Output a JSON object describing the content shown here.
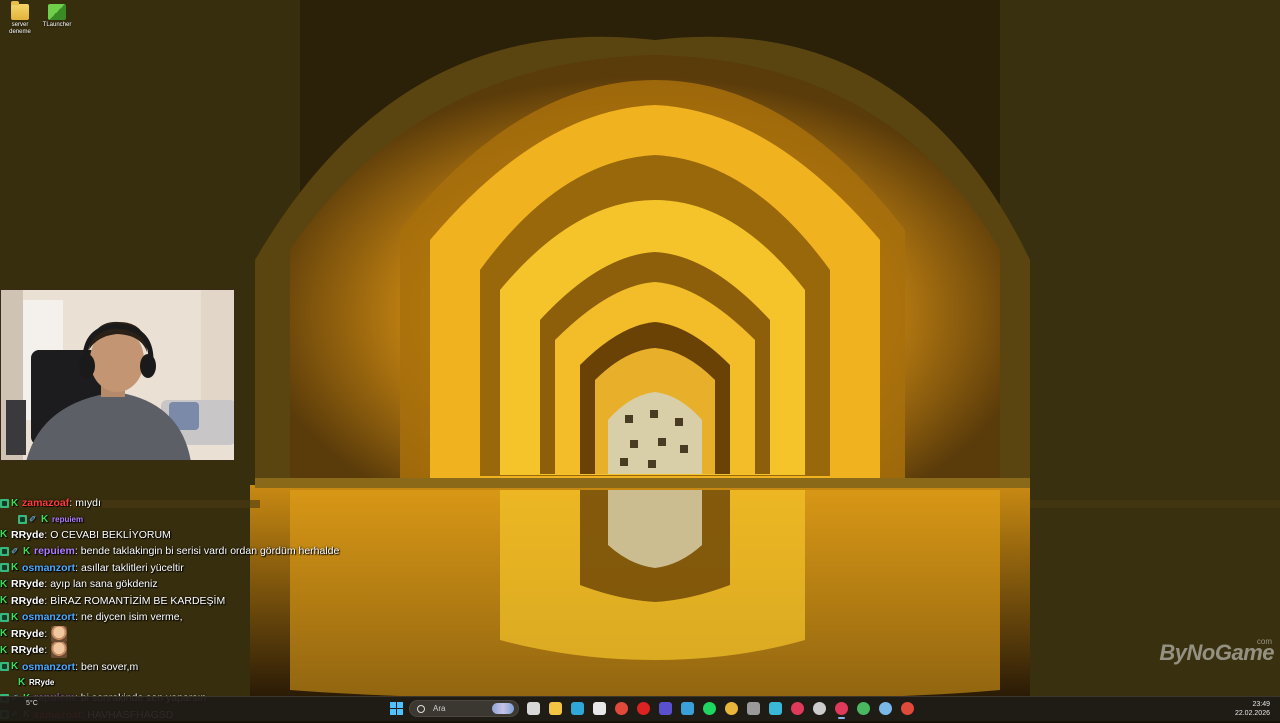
{
  "desktop": {
    "icons": [
      {
        "label": "server deneme",
        "icon": "folder-icon"
      },
      {
        "label": "TLauncher",
        "icon": "tlauncher-icon"
      }
    ]
  },
  "chat": {
    "messages": [
      {
        "user": "zamazoaf",
        "user_color": "#ff3b3b",
        "text": "mıydı",
        "badges": [
          "mod",
          "k"
        ]
      },
      {
        "reply": true,
        "user": "repuiem",
        "user_color": "#b07cff",
        "badges": [
          "mod",
          "sword",
          "k"
        ]
      },
      {
        "user": "RRyde",
        "user_color": "#ffffff",
        "text": "O CEVABI BEKLİYORUM",
        "badges": [
          "k"
        ]
      },
      {
        "user": "repuiem",
        "user_color": "#b07cff",
        "text": "bende taklakingin bi serisi vardı ordan gördüm herhalde",
        "badges": [
          "mod",
          "sword",
          "k"
        ]
      },
      {
        "user": "osmanzort",
        "user_color": "#4aa8ff",
        "text": "asıllar taklitleri yüceltir",
        "badges": [
          "mod",
          "k"
        ]
      },
      {
        "user": "RRyde",
        "user_color": "#ffffff",
        "text": "ayıp lan sana gökdeniz",
        "badges": [
          "k"
        ]
      },
      {
        "user": "RRyde",
        "user_color": "#ffffff",
        "text": "BİRAZ ROMANTİZİM BE KARDEŞİM",
        "badges": [
          "k"
        ]
      },
      {
        "user": "osmanzort",
        "user_color": "#4aa8ff",
        "text": "ne diycen isim verme,",
        "badges": [
          "mod",
          "k"
        ]
      },
      {
        "user": "RRyde",
        "user_color": "#ffffff",
        "text": "",
        "emote": true,
        "badges": [
          "k"
        ]
      },
      {
        "user": "RRyde",
        "user_color": "#ffffff",
        "text": "",
        "emote": true,
        "badges": [
          "k"
        ]
      },
      {
        "user": "osmanzort",
        "user_color": "#4aa8ff",
        "text": "ben sover,m",
        "badges": [
          "mod",
          "k"
        ]
      },
      {
        "reply": true,
        "user": "RRyde",
        "user_color": "#ffffff",
        "badges": [
          "k"
        ]
      },
      {
        "user": "repuiem",
        "user_color": "#b07cff",
        "text": "bi sonrakinde sen yaparsın",
        "badges": [
          "mod",
          "sword",
          "k"
        ]
      },
      {
        "user": "zamazoaf",
        "user_color": "#ff3b3b",
        "text": "HAVHASFHAGSD",
        "badges": [
          "mod",
          "sword",
          "k"
        ]
      }
    ]
  },
  "watermark": {
    "main": "ByNoGame",
    "sub": "com"
  },
  "taskbar": {
    "weather": "5°C",
    "search_placeholder": "Ara",
    "apps": [
      {
        "name": "task-view-icon",
        "color": "#d8d8d8"
      },
      {
        "name": "file-explorer-icon",
        "color": "#f4c542"
      },
      {
        "name": "edge-icon",
        "color": "#2fa8d8"
      },
      {
        "name": "notes-icon",
        "color": "#e8e8e8"
      },
      {
        "name": "chrome-icon",
        "color": "#e2493b"
      },
      {
        "name": "opera-icon",
        "color": "#d22"
      },
      {
        "name": "obs-icon",
        "color": "#5a4fcf"
      },
      {
        "name": "sticky-icon",
        "color": "#3aa0d8"
      },
      {
        "name": "spotify-icon",
        "color": "#1ed760"
      },
      {
        "name": "chrome-icon-2",
        "color": "#e8b73a"
      },
      {
        "name": "calculator-icon",
        "color": "#9a9a9a"
      },
      {
        "name": "photos-icon",
        "color": "#3ab8d8"
      },
      {
        "name": "opera-gx-icon",
        "color": "#e03a5a"
      },
      {
        "name": "github-icon",
        "color": "#cccccc"
      },
      {
        "name": "opera-gx-icon-2",
        "color": "#e03a5a"
      },
      {
        "name": "chrome-icon-3",
        "color": "#4ab860"
      },
      {
        "name": "steam-icon",
        "color": "#7ab8e8"
      },
      {
        "name": "chrome-icon-4",
        "color": "#e04a3a"
      }
    ],
    "time": "23:49",
    "date": "22.02.2026"
  }
}
